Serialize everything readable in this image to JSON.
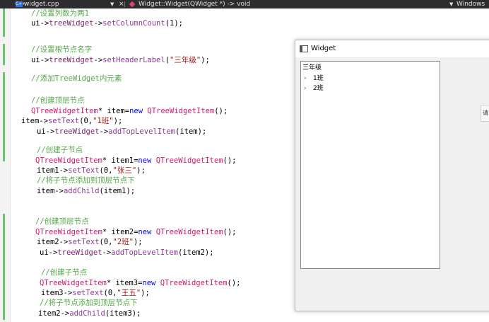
{
  "editor": {
    "file_tab": "widget.cpp",
    "symbol": "Widget::Widget(QWidget *) -> void",
    "platform": "Windows"
  },
  "code_lines": [
    [
      {
        "t": "com",
        "v": "//设置列数为两1"
      }
    ],
    [
      {
        "t": "plain",
        "v": "ui->"
      },
      {
        "t": "fld",
        "v": "treeWidget"
      },
      {
        "t": "plain",
        "v": "->"
      },
      {
        "t": "fn",
        "v": "setColumnCount"
      },
      {
        "t": "plain",
        "v": "(1);"
      }
    ],
    [
      {
        "t": "com",
        "v": "//设置根节点名字"
      }
    ],
    [
      {
        "t": "plain",
        "v": "ui->"
      },
      {
        "t": "fld",
        "v": "treeWidget"
      },
      {
        "t": "plain",
        "v": "->"
      },
      {
        "t": "fn",
        "v": "setHeaderLabel"
      },
      {
        "t": "plain",
        "v": "("
      },
      {
        "t": "str",
        "v": "\"三年级\""
      },
      {
        "t": "plain",
        "v": ");"
      }
    ],
    [
      {
        "t": "com",
        "v": "//添加TreeWidget内元素"
      }
    ],
    [
      {
        "t": "com",
        "v": "//创建顶层节点"
      }
    ],
    [
      {
        "t": "type",
        "v": "QTreeWidgetItem"
      },
      {
        "t": "plain",
        "v": "* item="
      },
      {
        "t": "kw",
        "v": "new"
      },
      {
        "t": "plain",
        "v": " "
      },
      {
        "t": "type",
        "v": "QTreeWidgetItem"
      },
      {
        "t": "plain",
        "v": "();"
      }
    ],
    [
      {
        "t": "plain",
        "v": "item->"
      },
      {
        "t": "fn",
        "v": "setText"
      },
      {
        "t": "plain",
        "v": "(0,"
      },
      {
        "t": "str",
        "v": "\"1班\""
      },
      {
        "t": "plain",
        "v": ");"
      }
    ],
    [
      {
        "t": "plain",
        "v": "ui->"
      },
      {
        "t": "fld",
        "v": "treeWidget"
      },
      {
        "t": "plain",
        "v": "->"
      },
      {
        "t": "fn",
        "v": "addTopLevelItem"
      },
      {
        "t": "plain",
        "v": "(item);"
      }
    ],
    [
      {
        "t": "com",
        "v": "//创建子节点"
      }
    ],
    [
      {
        "t": "type",
        "v": "QTreeWidgetItem"
      },
      {
        "t": "plain",
        "v": "* item1="
      },
      {
        "t": "kw",
        "v": "new"
      },
      {
        "t": "plain",
        "v": " "
      },
      {
        "t": "type",
        "v": "QTreeWidgetItem"
      },
      {
        "t": "plain",
        "v": "();"
      }
    ],
    [
      {
        "t": "plain",
        "v": "item1->"
      },
      {
        "t": "fn",
        "v": "setText"
      },
      {
        "t": "plain",
        "v": "(0,"
      },
      {
        "t": "str",
        "v": "\"张三\""
      },
      {
        "t": "plain",
        "v": ");"
      }
    ],
    [
      {
        "t": "com",
        "v": "//将子节点添加到顶层节点下"
      }
    ],
    [
      {
        "t": "plain",
        "v": "item->"
      },
      {
        "t": "fn",
        "v": "addChild"
      },
      {
        "t": "plain",
        "v": "(item1);"
      }
    ],
    [
      {
        "t": "com",
        "v": "//创建顶层节点"
      }
    ],
    [
      {
        "t": "type",
        "v": "QTreeWidgetItem"
      },
      {
        "t": "plain",
        "v": "* item2="
      },
      {
        "t": "kw",
        "v": "new"
      },
      {
        "t": "plain",
        "v": " "
      },
      {
        "t": "type",
        "v": "QTreeWidgetItem"
      },
      {
        "t": "plain",
        "v": "();"
      }
    ],
    [
      {
        "t": "plain",
        "v": "item2->"
      },
      {
        "t": "fn",
        "v": "setText"
      },
      {
        "t": "plain",
        "v": "(0,"
      },
      {
        "t": "str",
        "v": "\"2班\""
      },
      {
        "t": "plain",
        "v": ");"
      }
    ],
    [
      {
        "t": "plain",
        "v": "ui->"
      },
      {
        "t": "fld",
        "v": "treeWidget"
      },
      {
        "t": "plain",
        "v": "->"
      },
      {
        "t": "fn",
        "v": "addTopLevelItem"
      },
      {
        "t": "plain",
        "v": "(item2);"
      }
    ],
    [
      {
        "t": "com",
        "v": "//创建子节点"
      }
    ],
    [
      {
        "t": "type",
        "v": "QTreeWidgetItem"
      },
      {
        "t": "plain",
        "v": "* item3="
      },
      {
        "t": "kw",
        "v": "new"
      },
      {
        "t": "plain",
        "v": " "
      },
      {
        "t": "type",
        "v": "QTreeWidgetItem"
      },
      {
        "t": "plain",
        "v": "();"
      }
    ],
    [
      {
        "t": "plain",
        "v": "item3->"
      },
      {
        "t": "fn",
        "v": "setText"
      },
      {
        "t": "plain",
        "v": "(0,"
      },
      {
        "t": "str",
        "v": "\"王五\""
      },
      {
        "t": "plain",
        "v": ");"
      }
    ],
    [
      {
        "t": "com",
        "v": "//将子节点添加到顶层节点下"
      }
    ],
    [
      {
        "t": "plain",
        "v": "item2->"
      },
      {
        "t": "fn",
        "v": "addChild"
      },
      {
        "t": "plain",
        "v": "(item3);"
      }
    ]
  ],
  "widget_window": {
    "title": "Widget",
    "tree_header": "三年级",
    "tree_items": [
      "1班",
      "2班"
    ]
  },
  "side_tab_label": "请",
  "colors": {
    "comment": "#57a64a",
    "type": "#d01b6b",
    "keyword": "#0000ff",
    "function": "#8b3c94",
    "string": "#a31515"
  }
}
